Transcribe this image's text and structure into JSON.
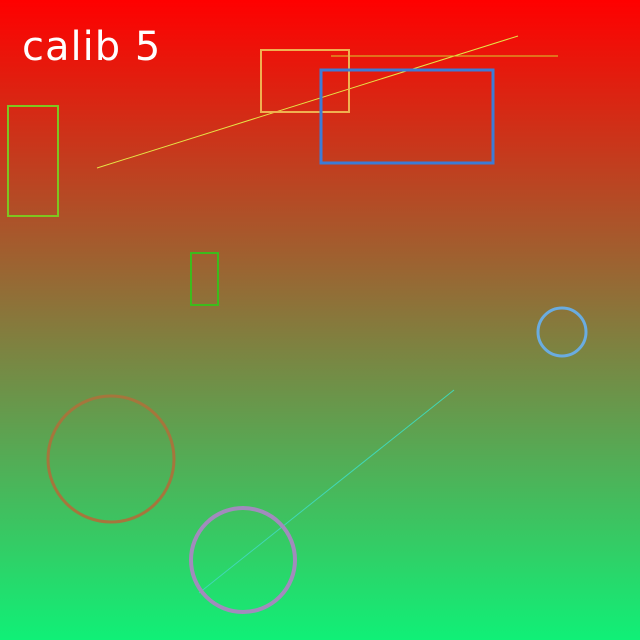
{
  "canvas": {
    "title": "calib 5",
    "background": {
      "top_color": "#ff0000",
      "bottom_color": "#10f077"
    }
  },
  "shapes": {
    "rectangles": [
      {
        "name": "orange-rectangle",
        "color": "#f0b050"
      },
      {
        "name": "blue-rectangle",
        "color": "#3d7bd6"
      },
      {
        "name": "green-tall-rectangle",
        "color": "#7ec620"
      },
      {
        "name": "green-small-rectangle",
        "color": "#3dbb1c"
      }
    ],
    "circles": [
      {
        "name": "light-blue-circle",
        "color": "#6aace0"
      },
      {
        "name": "brown-circle",
        "color": "#a5763c"
      },
      {
        "name": "purple-circle",
        "color": "#a28bbd"
      }
    ],
    "lines": [
      {
        "name": "yellow-diagonal-line",
        "color": "#e6e346"
      },
      {
        "name": "yellow-horizontal-line",
        "color": "#d8cf2e"
      },
      {
        "name": "cyan-diagonal-line",
        "color": "#41d7b5"
      }
    ]
  }
}
